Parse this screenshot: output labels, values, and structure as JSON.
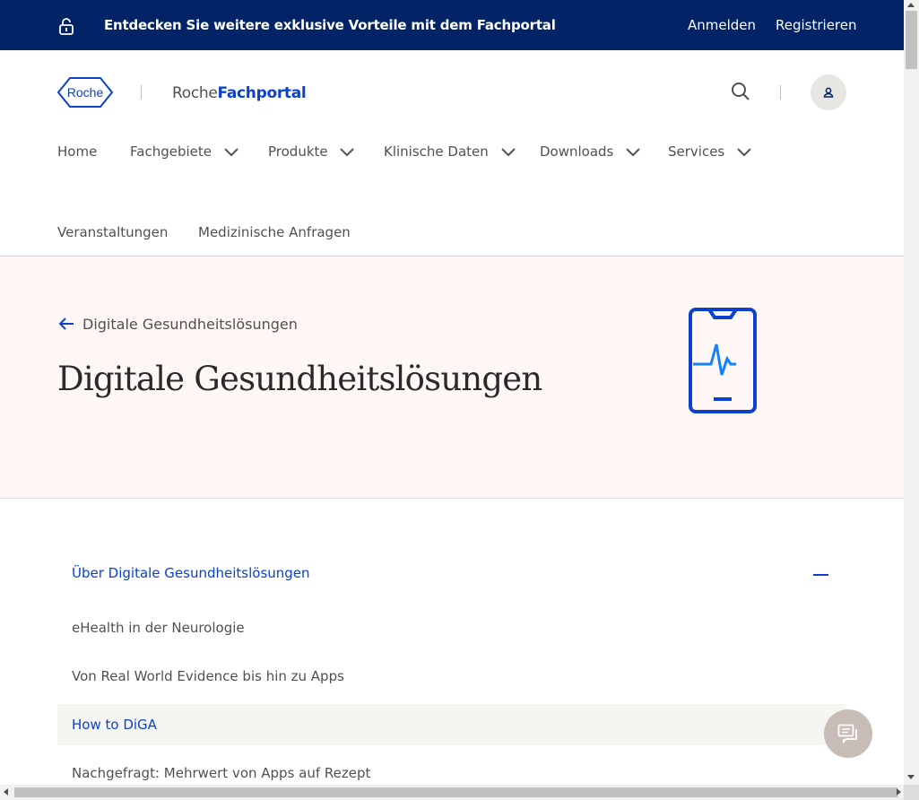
{
  "colors": {
    "banner_bg": "#022366",
    "brand_blue": "#0b41cd",
    "hero_bg": "#fff7f5",
    "text": "#544f4f",
    "chat_button": "#c7bcb6"
  },
  "banner": {
    "icon": "lock-open-icon",
    "promo_text": "Entdecken Sie weitere exklusive Vorteile mit dem Fachportal",
    "login_label": "Anmelden",
    "register_label": "Registrieren"
  },
  "header": {
    "logo_text": "Roche",
    "portal_prefix": "Roche",
    "portal_name": "Fachportal",
    "search_icon": "search-icon",
    "user_icon": "user-icon"
  },
  "nav": {
    "items": [
      {
        "label": "Home",
        "has_dropdown": false
      },
      {
        "label": "Fachgebiete",
        "has_dropdown": true
      },
      {
        "label": "Produkte",
        "has_dropdown": true
      },
      {
        "label": "Klinische Daten",
        "has_dropdown": true
      },
      {
        "label": "Downloads",
        "has_dropdown": true
      },
      {
        "label": "Services",
        "has_dropdown": true
      },
      {
        "label": "Veranstaltungen",
        "has_dropdown": false
      },
      {
        "label": "Medizinische Anfragen",
        "has_dropdown": false
      }
    ]
  },
  "hero": {
    "back_label": "Digitale Gesundheitslösungen",
    "title": "Digitale Gesundheitslösungen",
    "icon": "smartphone-heartbeat-icon"
  },
  "accordion": {
    "heading": "Über Digitale Gesundheitslösungen",
    "expanded": true,
    "items": [
      {
        "label": "eHealth in der Neurologie",
        "active": false
      },
      {
        "label": "Von Real World Evidence bis hin zu Apps",
        "active": false
      },
      {
        "label": "How to DiGA",
        "active": true
      },
      {
        "label": "Nachgefragt: Mehrwert von Apps auf Rezept",
        "active": false
      }
    ]
  },
  "chat": {
    "icon": "chat-icon"
  }
}
